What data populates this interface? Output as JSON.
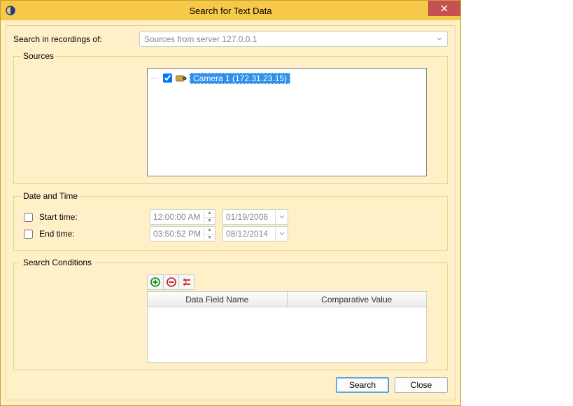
{
  "window": {
    "title": "Search for Text Data"
  },
  "recordings": {
    "label": "Search in recordings of:",
    "selected": "Sources from server 127.0.0.1"
  },
  "sources": {
    "legend": "Sources",
    "items": [
      {
        "checked": true,
        "label": "Camera 1 (172.31.23.15)"
      }
    ]
  },
  "datetime": {
    "legend": "Date and Time",
    "start": {
      "label": "Start time:",
      "checked": false,
      "time": "12:00:00 AM",
      "date": "01/19/2006"
    },
    "end": {
      "label": "End time:",
      "checked": false,
      "time": "03:50:52 PM",
      "date": "08/12/2014"
    }
  },
  "conditions": {
    "legend": "Search Conditions",
    "columns": {
      "field": "Data Field Name",
      "value": "Comparative Value"
    },
    "rows": []
  },
  "footer": {
    "search": "Search",
    "close": "Close"
  }
}
